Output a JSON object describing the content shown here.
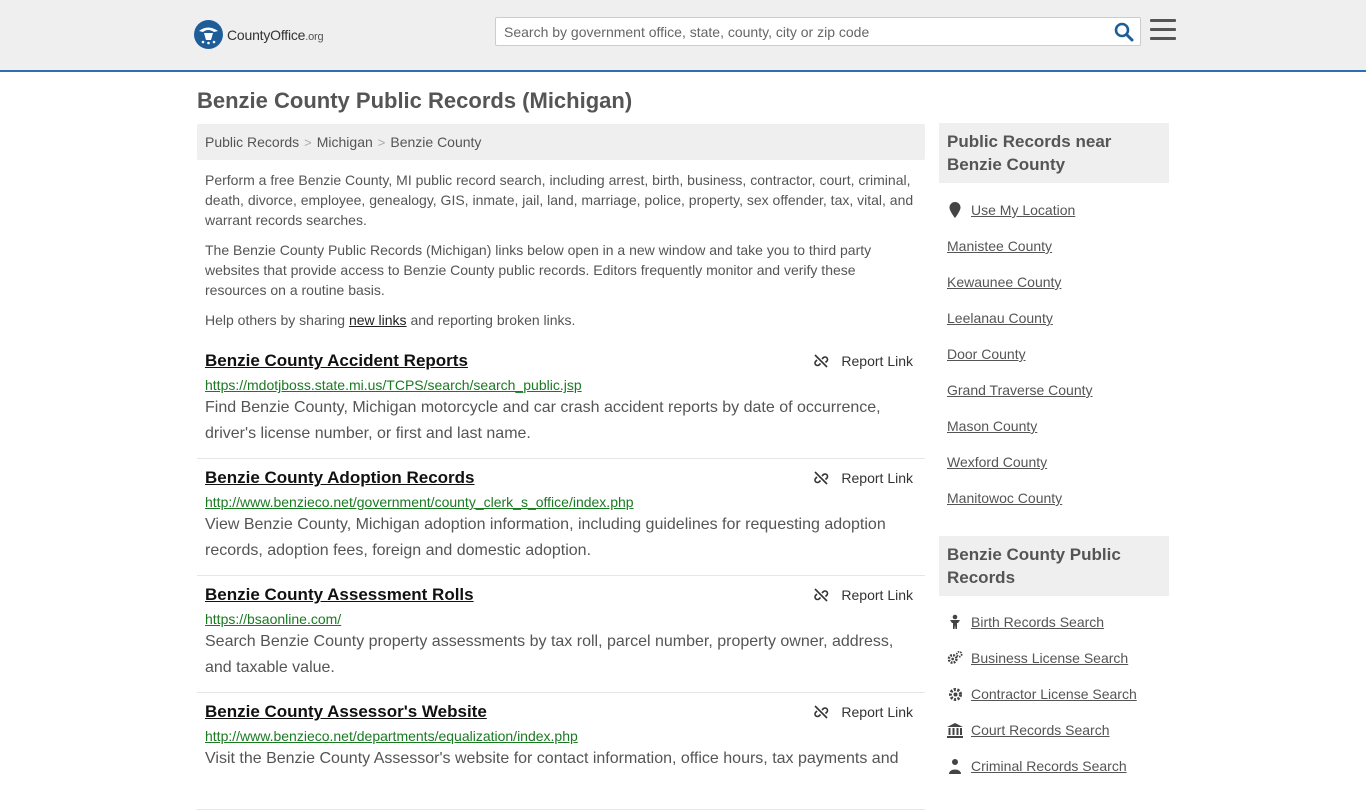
{
  "header": {
    "logo_brand": "CountyOffice",
    "logo_suffix": ".org",
    "search_placeholder": "Search by government office, state, county, city or zip code"
  },
  "page_title": "Benzie County Public Records (Michigan)",
  "breadcrumb": [
    "Public Records",
    "Michigan",
    "Benzie County"
  ],
  "intro": {
    "p1": "Perform a free Benzie County, MI public record search, including arrest, birth, business, contractor, court, criminal, death, divorce, employee, genealogy, GIS, inmate, jail, land, marriage, police, property, sex offender, tax, vital, and warrant records searches.",
    "p2": "The Benzie County Public Records (Michigan) links below open in a new window and take you to third party websites that provide access to Benzie County public records. Editors frequently monitor and verify these resources on a routine basis.",
    "p3_before": "Help others by sharing ",
    "p3_link": "new links",
    "p3_after": " and reporting broken links."
  },
  "report_label": "Report Link",
  "records": [
    {
      "title": "Benzie County Accident Reports",
      "url": "https://mdotjboss.state.mi.us/TCPS/search/search_public.jsp",
      "desc": "Find Benzie County, Michigan motorcycle and car crash accident reports by date of occurrence, driver's license number, or first and last name."
    },
    {
      "title": "Benzie County Adoption Records",
      "url": "http://www.benzieco.net/government/county_clerk_s_office/index.php",
      "desc": "View Benzie County, Michigan adoption information, including guidelines for requesting adoption records, adoption fees, foreign and domestic adoption."
    },
    {
      "title": "Benzie County Assessment Rolls",
      "url": "https://bsaonline.com/",
      "desc": "Search Benzie County property assessments by tax roll, parcel number, property owner, address, and taxable value."
    },
    {
      "title": "Benzie County Assessor's Website",
      "url": "http://www.benzieco.net/departments/equalization/index.php",
      "desc": "Visit the Benzie County Assessor's website for contact information, office hours, tax payments and"
    }
  ],
  "sidebar": {
    "near_title": "Public Records near Benzie County",
    "use_location": "Use My Location",
    "near_counties": [
      "Manistee County",
      "Kewaunee County",
      "Leelanau County",
      "Door County",
      "Grand Traverse County",
      "Mason County",
      "Wexford County",
      "Manitowoc County"
    ],
    "records_title": "Benzie County Public Records",
    "record_links": [
      {
        "label": "Birth Records Search",
        "icon": "baby-icon"
      },
      {
        "label": "Business License Search",
        "icon": "gears-icon"
      },
      {
        "label": "Contractor License Search",
        "icon": "gear-icon"
      },
      {
        "label": "Court Records Search",
        "icon": "courthouse-icon"
      },
      {
        "label": "Criminal Records Search",
        "icon": "criminal-icon"
      }
    ]
  },
  "colors": {
    "accent": "#2f6fb0",
    "url_green": "#1a7a22",
    "panel": "#efefef"
  }
}
